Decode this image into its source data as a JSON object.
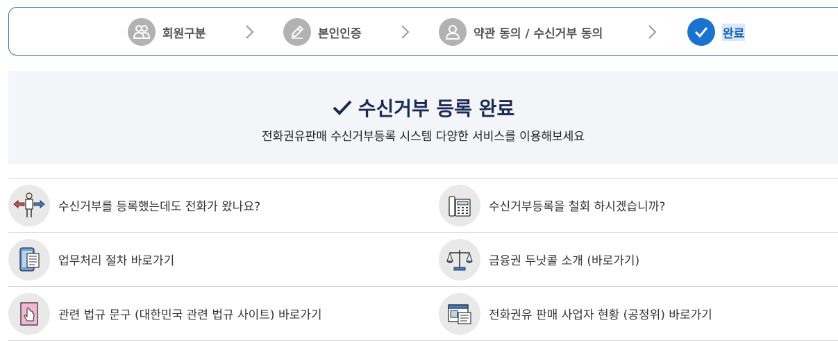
{
  "stepper": {
    "steps": [
      {
        "label": "회원구분",
        "icon": "users-icon"
      },
      {
        "label": "본인인증",
        "icon": "pencil-icon"
      },
      {
        "label": "약관 동의 / 수신거부 동의",
        "icon": "user-icon"
      },
      {
        "label": "완료",
        "icon": "check-icon"
      }
    ]
  },
  "banner": {
    "title": "수신거부 등록 완료",
    "subtitle": "전화권유판매 수신거부등록 시스템 다양한 서비스를 이용해보세요"
  },
  "links": [
    {
      "label": "수신거부를 등록했는데도 전화가 왔나요?",
      "icon": "person-arrows-icon"
    },
    {
      "label": "수신거부등록을 철회 하시겠습니까?",
      "icon": "telephone-icon"
    },
    {
      "label": "업무처리 절차 바로가기",
      "icon": "tablet-document-icon"
    },
    {
      "label": "금융권 두낫콜 소개 (바로가기)",
      "icon": "scale-icon"
    },
    {
      "label": "관련 법규 문구 (대한민국 관련 법규 사이트) 바로가기",
      "icon": "hand-pointer-icon"
    },
    {
      "label": "전화권유 판매 사업자 현황 (공정위) 바로가기",
      "icon": "window-list-icon"
    }
  ],
  "colors": {
    "accent": "#1a73cf",
    "title": "#1b2a55",
    "inactive": "#b2b2b2",
    "border": "#2f6fb6",
    "banner_bg": "#f4f5f9"
  }
}
